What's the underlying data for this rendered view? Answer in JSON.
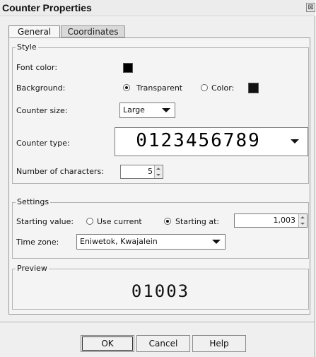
{
  "window": {
    "title": "Counter Properties",
    "close_glyph": "⊠"
  },
  "tabs": [
    {
      "label": "General",
      "active": true
    },
    {
      "label": "Coordinates",
      "active": false
    }
  ],
  "style": {
    "legend": "Style",
    "font_color_label": "Font color:",
    "font_color": "#000000",
    "background_label": "Background:",
    "background_options": [
      "Transparent",
      "Color:"
    ],
    "background_selected": "Transparent",
    "background_color": "#111111",
    "size_label": "Counter size:",
    "size_value": "Large",
    "type_label": "Counter type:",
    "type_sample": "0123456789",
    "num_chars_label": "Number of characters:",
    "num_chars_value": "5"
  },
  "settings": {
    "legend": "Settings",
    "starting_value_label": "Starting value:",
    "options": [
      "Use current",
      "Starting at:"
    ],
    "selected": "Starting at:",
    "starting_at_value": "1,003",
    "time_zone_label": "Time zone:",
    "time_zone_value": "Eniwetok, Kwajalein"
  },
  "preview": {
    "legend": "Preview",
    "value": "01003"
  },
  "buttons": {
    "ok": "OK",
    "cancel": "Cancel",
    "help": "Help"
  },
  "icons": {
    "dropdown": "chevron-down-icon",
    "spinner": "spinner-arrows-icon",
    "close": "close-icon"
  }
}
